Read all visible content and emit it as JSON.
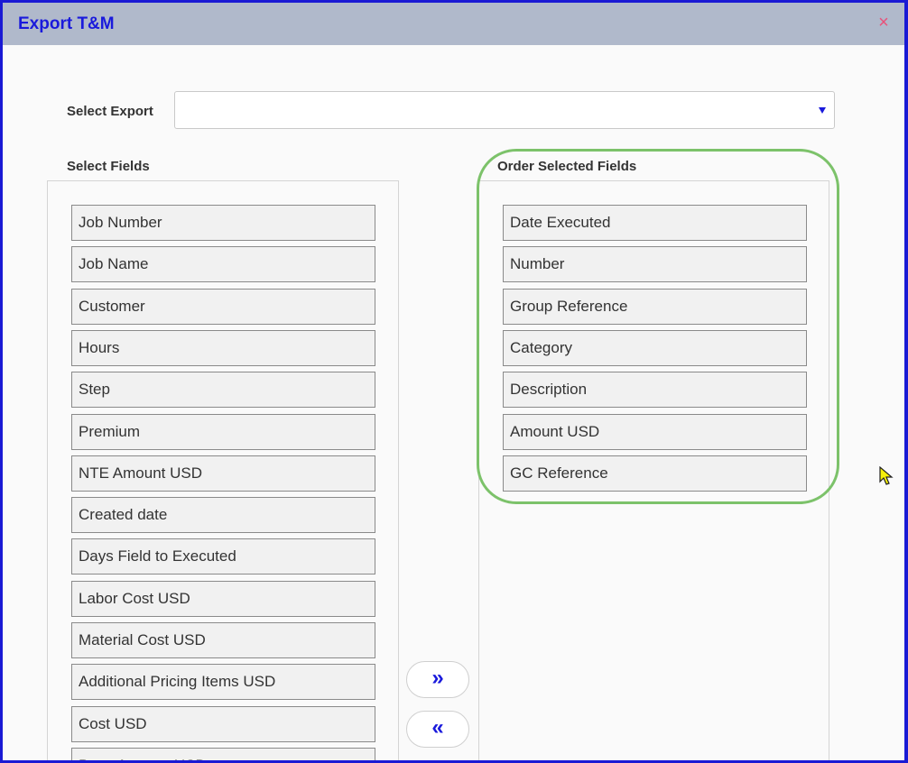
{
  "dialog": {
    "title": "Export T&M",
    "close_glyph": "×"
  },
  "select_export": {
    "label": "Select Export",
    "value": ""
  },
  "select_fields": {
    "heading": "Select Fields",
    "items": [
      "Job Number",
      "Job Name",
      "Customer",
      "Hours",
      "Step",
      "Premium",
      "NTE Amount USD",
      "Created date",
      "Days Field to Executed",
      "Labor Cost USD",
      "Material Cost USD",
      "Additional Pricing Items USD",
      "Cost USD",
      "Base Amount USD"
    ]
  },
  "order_fields": {
    "heading": "Order Selected Fields",
    "items": [
      "Date Executed",
      "Number",
      "Group Reference",
      "Category",
      "Description",
      "Amount USD",
      "GC Reference"
    ]
  },
  "buttons": {
    "add_all_glyph": "»",
    "remove_all_glyph": "«"
  },
  "colors": {
    "accent": "#1a1adc",
    "title_bar": "#b0b9cb",
    "close": "#e8527a",
    "highlight": "#7cc26a"
  }
}
